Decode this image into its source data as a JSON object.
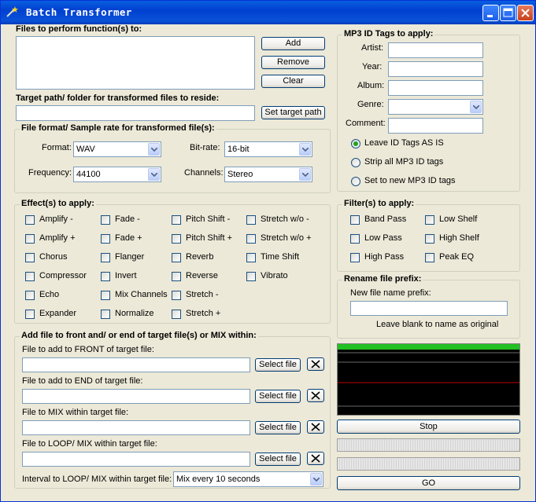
{
  "window": {
    "title": "Batch Transformer"
  },
  "files_section": {
    "heading": "Files to perform function(s) to:",
    "add_label": "Add",
    "remove_label": "Remove",
    "clear_label": "Clear"
  },
  "target_section": {
    "heading": "Target path/ folder for transformed files to reside:",
    "path_value": "",
    "set_target_label": "Set target path"
  },
  "format_section": {
    "heading": "File format/ Sample rate for transformed file(s):",
    "format_label": "Format:",
    "format_value": "WAV",
    "bitrate_label": "Bit-rate:",
    "bitrate_value": "16-bit",
    "frequency_label": "Frequency:",
    "frequency_value": "44100",
    "channels_label": "Channels:",
    "channels_value": "Stereo"
  },
  "effects_section": {
    "heading": "Effect(s) to apply:",
    "items": [
      "Amplify -",
      "Fade -",
      "Pitch Shift -",
      "Stretch w/o -",
      "Amplify +",
      "Fade +",
      "Pitch Shift +",
      "Stretch w/o +",
      "Chorus",
      "Flanger",
      "Reverb",
      "Time Shift",
      "Compressor",
      "Invert",
      "Reverse",
      "Vibrato",
      "Echo",
      "Mix Channels",
      "Stretch -",
      "Expander",
      "Normalize",
      "Stretch +"
    ]
  },
  "addfile_section": {
    "heading": "Add file to front and/ or end of target file(s) or MIX within:",
    "front_label": "File to add to FRONT of target file:",
    "end_label": "File to add to END of target file:",
    "mix_label": "File to MIX within target file:",
    "loop_label": "File to LOOP/ MIX within target file:",
    "select_label": "Select file",
    "interval_label": "Interval to LOOP/ MIX within target file:",
    "interval_value": "Mix every 10 seconds"
  },
  "mp3_section": {
    "heading": "MP3 ID Tags to apply:",
    "artist_label": "Artist:",
    "year_label": "Year:",
    "album_label": "Album:",
    "genre_label": "Genre:",
    "comment_label": "Comment:",
    "radio_leave": "Leave ID Tags AS IS",
    "radio_strip": "Strip all MP3 ID tags",
    "radio_set": "Set to new MP3 ID tags",
    "selected": "leave"
  },
  "filters_section": {
    "heading": "Filter(s) to apply:",
    "items": [
      "Band Pass",
      "Low Shelf",
      "Low Pass",
      "High Shelf",
      "High Pass",
      "Peak EQ"
    ]
  },
  "rename_section": {
    "heading": "Rename file prefix:",
    "new_prefix_label": "New file name prefix:",
    "hint": "Leave blank to name as original"
  },
  "controls": {
    "stop_label": "Stop",
    "go_label": "GO"
  },
  "colors": {
    "titlebar": "#0a52d8",
    "scope_green": "#22c022",
    "scope_red": "#c00000"
  }
}
